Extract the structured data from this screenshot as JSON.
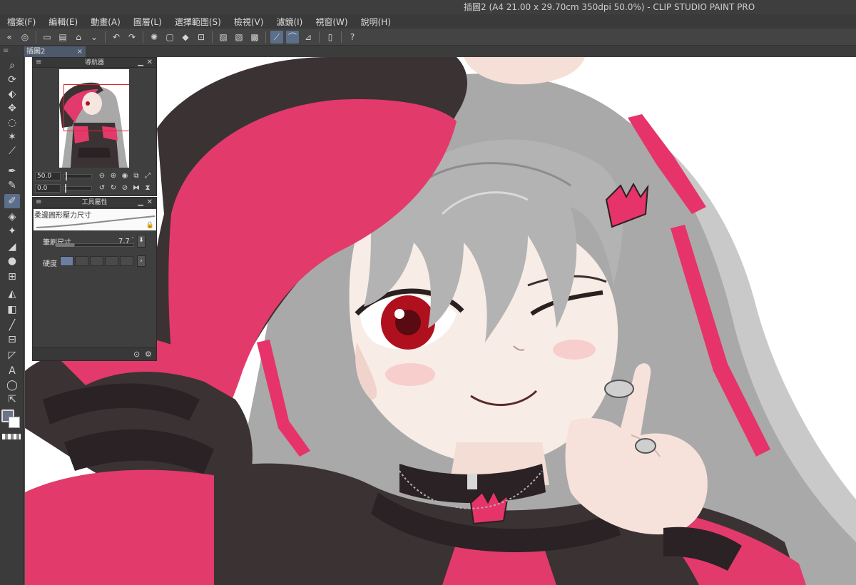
{
  "window": {
    "title": "插圖2 (A4 21.00 x 29.70cm 350dpi 50.0%)  - CLIP STUDIO PAINT PRO"
  },
  "menu": {
    "items": [
      "檔案(F)",
      "編輯(E)",
      "動畫(A)",
      "圖層(L)",
      "選擇範圍(S)",
      "檢視(V)",
      "濾鏡(I)",
      "視窗(W)",
      "說明(H)"
    ]
  },
  "command_bar": {
    "icons": [
      "app-icon",
      "new-file-icon",
      "open-file-icon",
      "save-icon",
      "export-icon",
      "undo-icon",
      "redo-icon",
      "loading-icon",
      "clear-icon",
      "fill-icon",
      "transform-icon",
      "hide-selection-icon",
      "show-border-icon",
      "snap-icon",
      "ruler-snap-icon",
      "grid-snap-icon",
      "symmetry-icon",
      "phone-icon",
      "help-icon"
    ]
  },
  "document_tab": {
    "label": "插圖2",
    "close": "×"
  },
  "navigator": {
    "title": "導航器",
    "zoom_value": "50.0",
    "rotate_value": "0.0"
  },
  "tool_property": {
    "title": "工具屬性",
    "brush_name": "柔邊圓形壓力尺寸",
    "size_label": "筆刷尺寸",
    "size_value": "7.7",
    "hardness_label": "硬度",
    "hardness_level": 1,
    "hardness_steps": 5
  },
  "tools": [
    "zoom-tool-icon",
    "rotate-tool-icon",
    "object-tool-icon",
    "move-tool-icon",
    "lasso-tool-icon",
    "magic-wand-icon",
    "eyedropper-icon",
    "pen-icon",
    "pencil-icon",
    "brush-icon",
    "airbrush-icon",
    "decoration-icon",
    "eraser-icon",
    "blend-icon",
    "frame-icon",
    "fill-bucket-icon",
    "gradient-icon",
    "line-icon",
    "ruler-icon",
    "shape-icon",
    "text-icon",
    "balloon-icon",
    "correct-line-icon"
  ],
  "colors": {
    "main_color": "#6c7488",
    "sub_color": "#ffffff",
    "accent": "#5b6f8b"
  }
}
